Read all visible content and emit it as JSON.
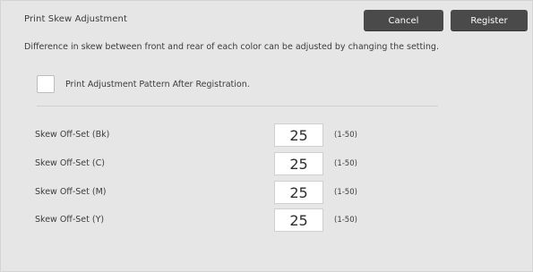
{
  "header": {
    "title": "Print Skew Adjustment",
    "cancel_label": "Cancel",
    "register_label": "Register"
  },
  "description": "Difference in skew between front and rear of each color can be adjusted by changing the setting.",
  "checkbox": {
    "label": "Print Adjustment Pattern After Registration.",
    "checked": false
  },
  "settings": [
    {
      "label": "Skew Off-Set (Bk)",
      "value": "25",
      "range": "(1-50)"
    },
    {
      "label": "Skew Off-Set (C)",
      "value": "25",
      "range": "(1-50)"
    },
    {
      "label": "Skew Off-Set (M)",
      "value": "25",
      "range": "(1-50)"
    },
    {
      "label": "Skew Off-Set (Y)",
      "value": "25",
      "range": "(1-50)"
    }
  ]
}
